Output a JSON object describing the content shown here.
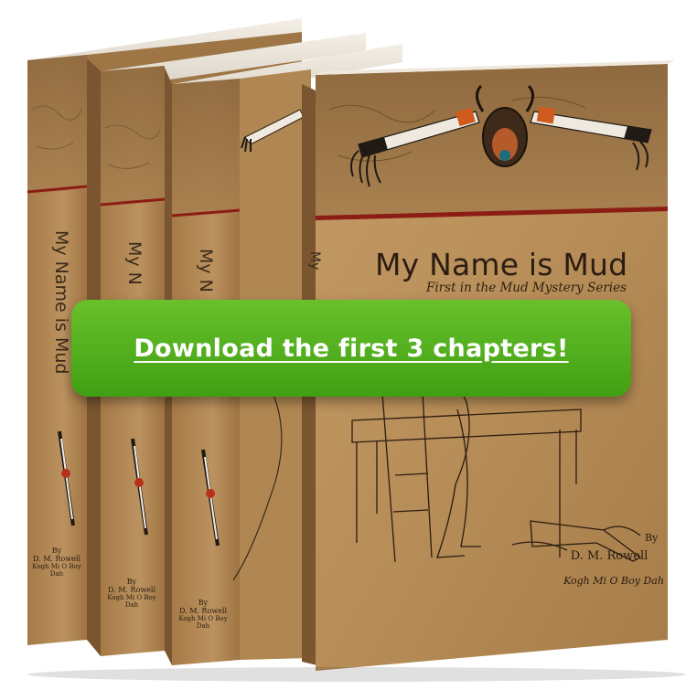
{
  "book": {
    "title": "My Name is Mud",
    "subtitle": "First in the Mud Mystery Series",
    "by": "By",
    "author": "D. M. Rowell",
    "author_alt": "Kogh Mi O Boy Dah",
    "spine_title_1": "My Name is Mud",
    "spine_title_2": "My N",
    "spine_title_3": "My N",
    "spine_title_4": "My"
  },
  "cta": {
    "label": "Download the first 3 chapters!"
  },
  "colors": {
    "cta_green": "#4cab1b",
    "paper": "#b38a56",
    "stripe_red": "#8b1d14"
  }
}
